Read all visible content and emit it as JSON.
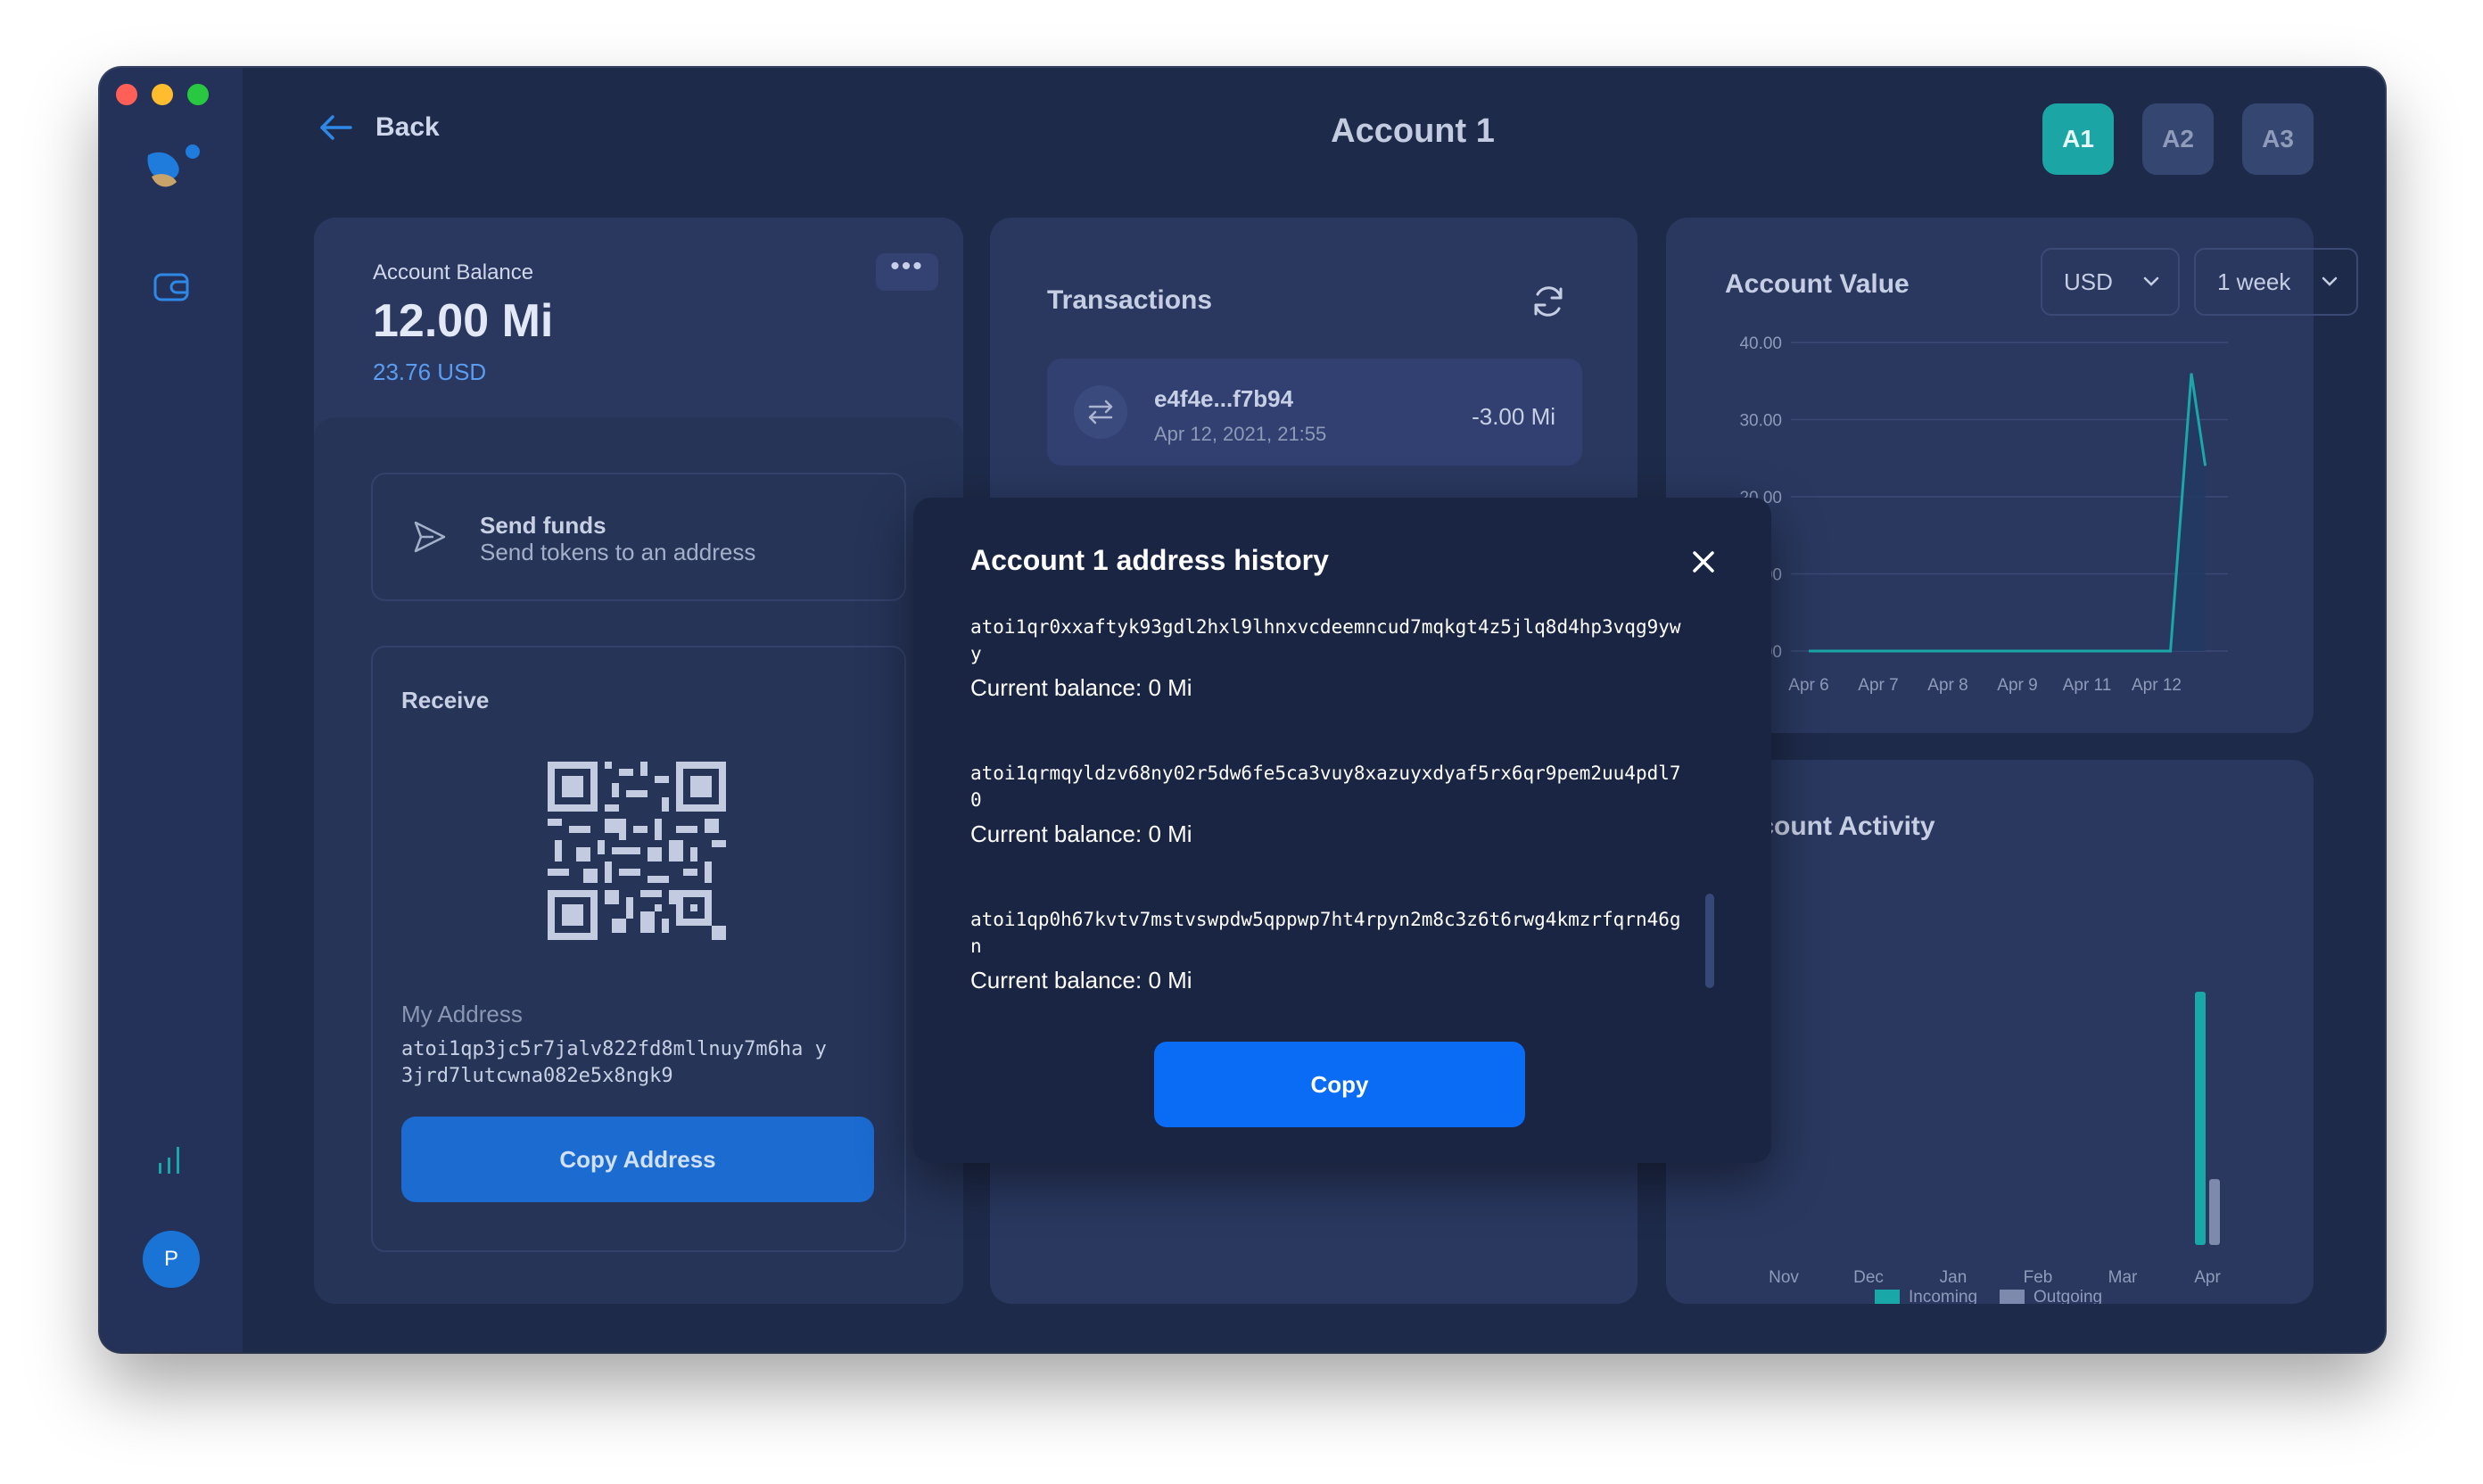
{
  "header": {
    "back_label": "Back",
    "title": "Account 1"
  },
  "accounts": [
    {
      "label": "A1",
      "active": true
    },
    {
      "label": "A2",
      "active": false
    },
    {
      "label": "A3",
      "active": false
    }
  ],
  "sidebar": {
    "avatar_initial": "P"
  },
  "balance": {
    "label": "Account Balance",
    "value": "12.00 Mi",
    "fiat": "23.76 USD",
    "menu_label": "•••"
  },
  "send": {
    "title": "Send funds",
    "subtitle": "Send tokens to an address"
  },
  "receive": {
    "title": "Receive",
    "address_label": "My Address",
    "address": "atoi1qp3jc5r7jalv822fd8mllnuy7m6ha y3jrd7lutcwna082e5x8ngk9",
    "copy_label": "Copy Address"
  },
  "transactions": {
    "title": "Transactions",
    "items": [
      {
        "hash": "e4f4e...f7b94",
        "date": "Apr 12, 2021, 21:55",
        "amount": "-3.00 Mi"
      }
    ]
  },
  "account_value": {
    "title": "Account Value",
    "currency": "USD",
    "range": "1 week"
  },
  "chart_data": [
    {
      "type": "line",
      "title": "Account Value",
      "x": [
        "Apr 6",
        "Apr 7",
        "Apr 8",
        "Apr 9",
        "Apr 11",
        "Apr 12"
      ],
      "yticks": [
        "40.00",
        "30.00",
        "20.00",
        "10.00",
        "0.00"
      ],
      "ylim": [
        0,
        40
      ],
      "series": [
        {
          "points": [
            [
              0,
              0
            ],
            [
              1,
              0
            ],
            [
              2,
              0
            ],
            [
              3,
              0
            ],
            [
              4,
              0
            ],
            [
              5.2,
              0
            ],
            [
              5.5,
              36
            ],
            [
              5.7,
              24
            ]
          ]
        }
      ],
      "color": "#1aa7a7"
    },
    {
      "type": "bar",
      "title": "Account Activity",
      "categories": [
        "Nov",
        "Dec",
        "Jan",
        "Feb",
        "Mar",
        "Apr"
      ],
      "series": [
        {
          "name": "Incoming",
          "values": [
            0,
            0,
            0,
            0,
            0,
            1.0
          ],
          "color": "#1aa7a7"
        },
        {
          "name": "Outgoing",
          "values": [
            0,
            0,
            0,
            0,
            0,
            0.26
          ],
          "color": "#7d89ad"
        }
      ]
    }
  ],
  "modal": {
    "title": "Account 1 address history",
    "copy_label": "Copy",
    "addresses": [
      {
        "address": "atoi1qr0xxaftyk93gdl2hxl9lhnxvcdeemncud7mqkgt4z5jlq8d4hp3vqg9ywy",
        "balance": "Current balance: 0 Mi"
      },
      {
        "address": "atoi1qrmqyldzv68ny02r5dw6fe5ca3vuy8xazuyxdyaf5rx6qr9pem2uu4pdl70",
        "balance": "Current balance: 0 Mi"
      },
      {
        "address": "atoi1qp0h67kvtv7mstvswpdw5qppwp7ht4rpyn2m8c3z6t6rwg4kmzrfqrn46gn",
        "balance": "Current balance: 0 Mi"
      }
    ]
  }
}
